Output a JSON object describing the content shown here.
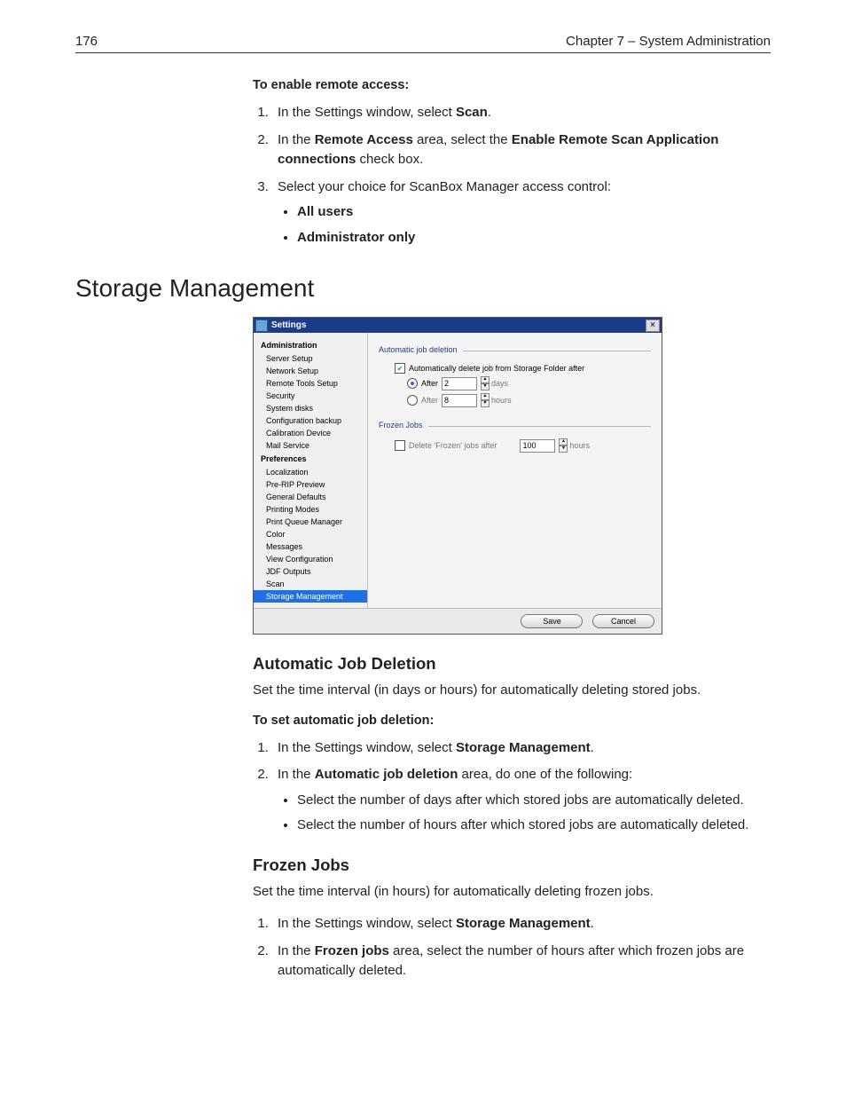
{
  "header": {
    "page_number": "176",
    "chapter": "Chapter 7 – System Administration"
  },
  "remote_access": {
    "heading": "To enable remote access:",
    "step1_a": "In the Settings window, select ",
    "step1_b": "Scan",
    "step1_c": ".",
    "step2_a": "In the ",
    "step2_b": "Remote Access",
    "step2_c": " area, select the ",
    "step2_d": "Enable Remote Scan Application connections",
    "step2_e": " check box.",
    "step3": "Select your choice for ScanBox Manager access control:",
    "bullet1": "All users",
    "bullet2": "Administrator only"
  },
  "section_title": "Storage Management",
  "dialog": {
    "title": "Settings",
    "sidebar": {
      "admin_header": "Administration",
      "admin_items": [
        "Server Setup",
        "Network Setup",
        "Remote Tools Setup",
        "Security",
        "System disks",
        "Configuration backup",
        "Calibration Device",
        "Mail Service"
      ],
      "pref_header": "Preferences",
      "pref_items": [
        "Localization",
        "Pre-RIP Preview",
        "General Defaults",
        "Printing Modes",
        "Print Queue Manager",
        "Color",
        "Messages",
        "View Configuration",
        "JDF Outputs",
        "Scan",
        "Storage Management"
      ],
      "selected": "Storage Management"
    },
    "panel": {
      "auto_legend": "Automatic job deletion",
      "auto_check_label": "Automatically delete job from Storage Folder after",
      "after_label": "After",
      "days_value": "2",
      "days_unit": "days",
      "hours_value": "8",
      "hours_unit": "hours",
      "frozen_legend": "Frozen Jobs",
      "frozen_label": "Delete 'Frozen' jobs after",
      "frozen_value": "100",
      "frozen_unit": "hours"
    },
    "buttons": {
      "save": "Save",
      "cancel": "Cancel"
    }
  },
  "auto_section": {
    "title": "Automatic Job Deletion",
    "desc": "Set the time interval (in days or hours) for automatically deleting stored jobs.",
    "heading": "To set automatic job deletion:",
    "step1_a": "In the Settings window, select ",
    "step1_b": "Storage Management",
    "step1_c": ".",
    "step2_a": "In the ",
    "step2_b": "Automatic job deletion",
    "step2_c": " area, do one of the following:",
    "bullet1": "Select the number of days after which stored jobs are automatically deleted.",
    "bullet2": "Select the number of hours after which stored jobs are automatically deleted."
  },
  "frozen_section": {
    "title": "Frozen Jobs",
    "desc": "Set the time interval (in hours) for automatically deleting frozen jobs.",
    "step1_a": "In the Settings window, select ",
    "step1_b": "Storage Management",
    "step1_c": ".",
    "step2_a": "In the ",
    "step2_b": "Frozen jobs",
    "step2_c": " area, select the number of hours after which frozen jobs are automatically deleted."
  }
}
